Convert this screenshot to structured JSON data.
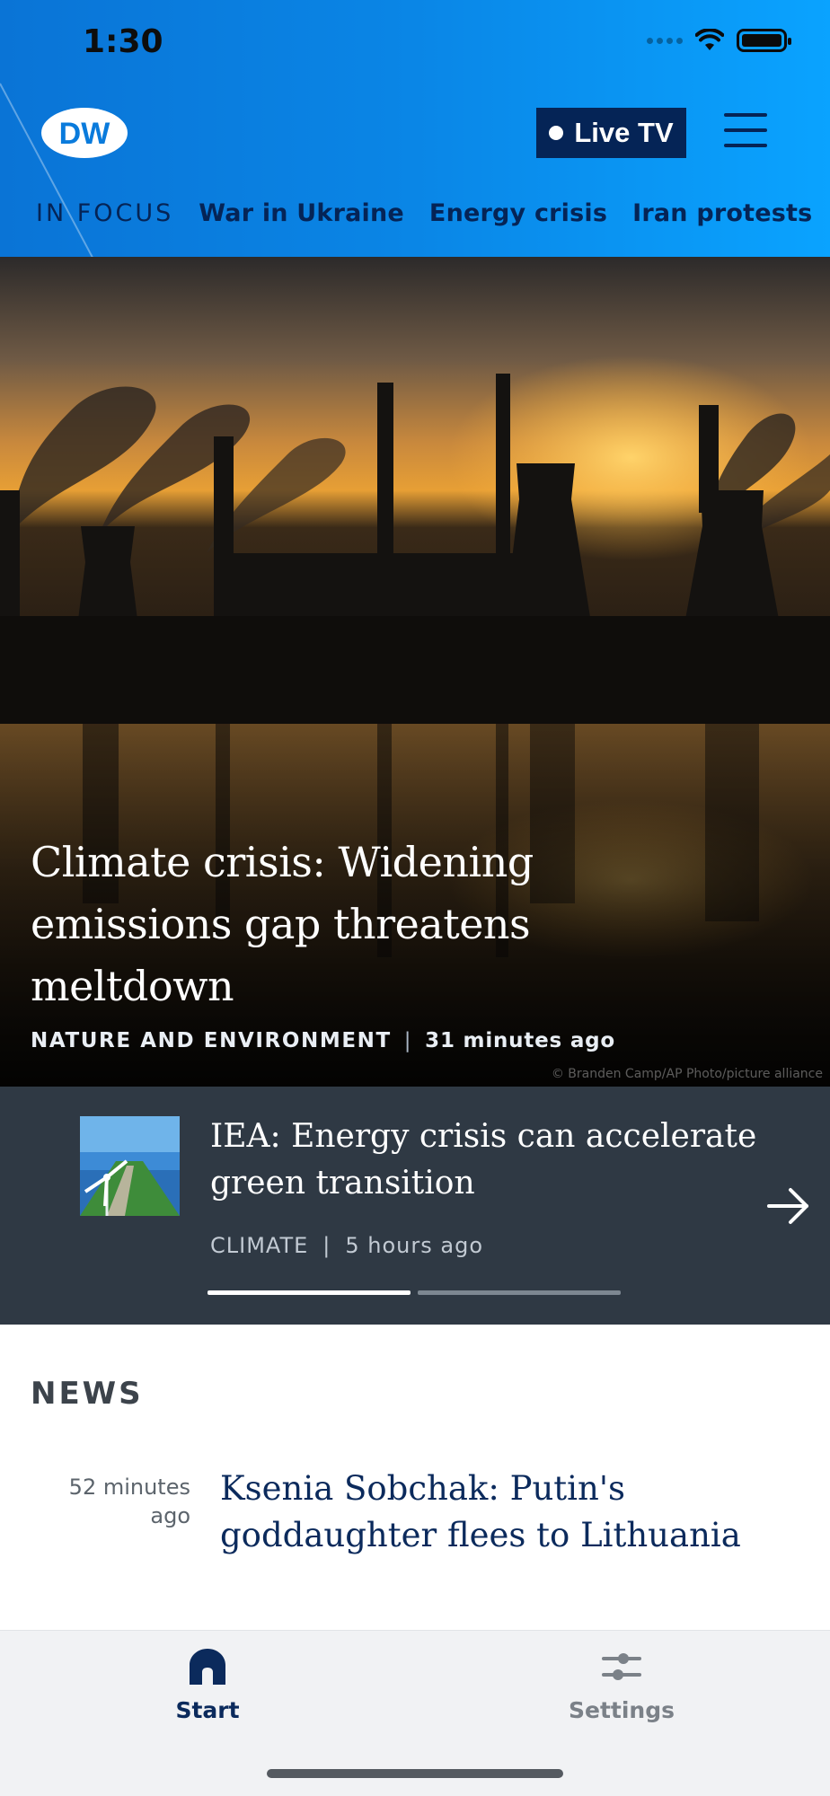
{
  "status_bar": {
    "time": "1:30"
  },
  "header": {
    "logo": "DW",
    "live_tv_label": "Live TV",
    "focus_label": "IN FOCUS",
    "focus_links": [
      "War in Ukraine",
      "Energy crisis",
      "Iran protests"
    ]
  },
  "hero": {
    "title": "Climate crisis: Widening emissions gap threatens meltdown",
    "category": "NATURE AND ENVIRONMENT",
    "separator": "|",
    "time": "31 minutes ago",
    "credit": "© Branden Camp/AP Photo/picture alliance"
  },
  "card": {
    "title": "IEA: Energy crisis can accelerate green transition",
    "category": "CLIMATE",
    "separator": "|",
    "time": "5 hours ago",
    "slides_total": 2,
    "slide_active": 1
  },
  "news": {
    "heading": "NEWS",
    "items": [
      {
        "time": "52 minutes ago",
        "title": "Ksenia Sobchak: Putin's goddaughter flees to Lithuania"
      }
    ]
  },
  "tabbar": {
    "tabs": [
      {
        "label": "Start",
        "icon": "home-icon",
        "active": true
      },
      {
        "label": "Settings",
        "icon": "sliders-icon",
        "active": false
      }
    ]
  },
  "colors": {
    "header_start": "#0a74d6",
    "header_end": "#0aa3ff",
    "brand_navy": "#052456",
    "card_bg": "#2f3944",
    "tabbar_bg": "#f1f2f4"
  }
}
